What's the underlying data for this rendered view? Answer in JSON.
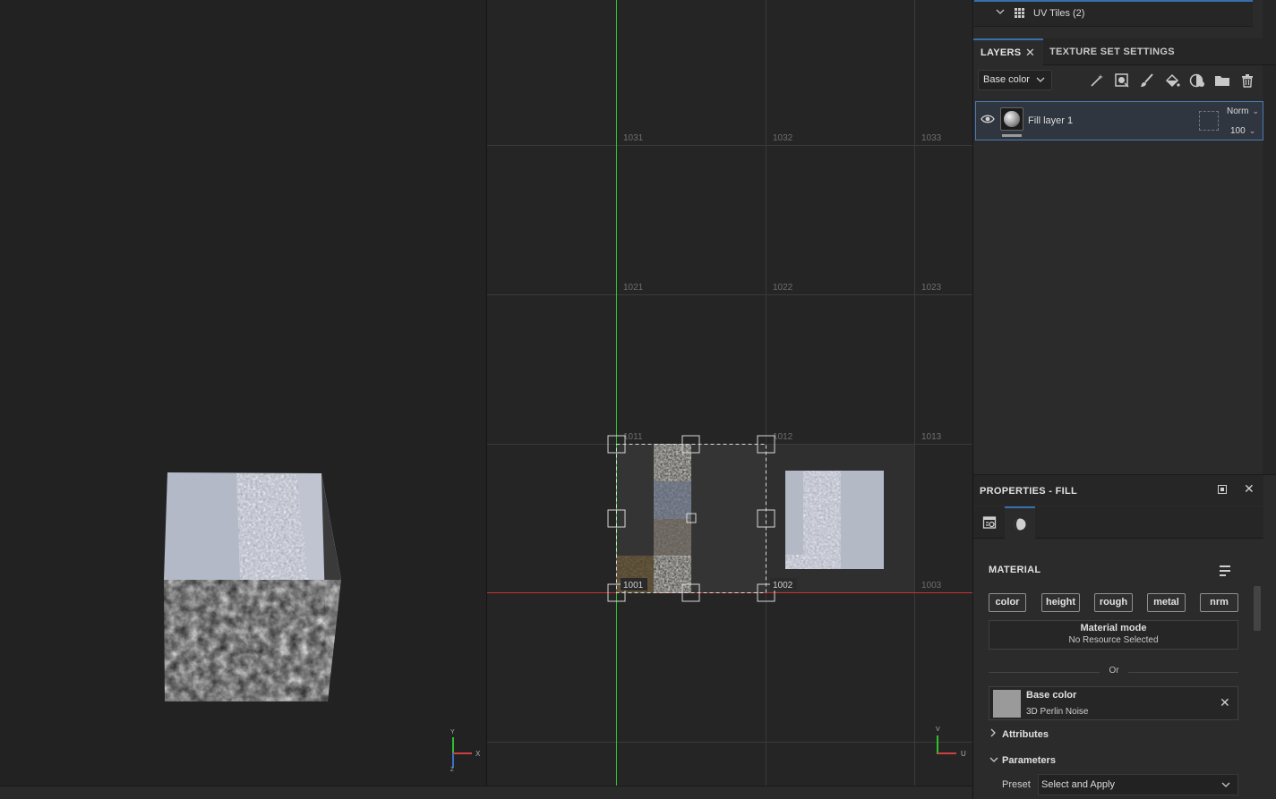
{
  "uv_tiles_row": {
    "label": "UV Tiles (2)"
  },
  "layers_panel": {
    "tabs": [
      {
        "label": "LAYERS",
        "close": "✕"
      },
      {
        "label": "TEXTURE SET SETTINGS"
      }
    ],
    "channel_select": "Base color",
    "toolbar_icons": [
      "magic-wand-icon",
      "add-mask-icon",
      "paint-layer-icon",
      "fill-layer-icon",
      "smart-material-icon",
      "folder-icon",
      "trash-icon"
    ],
    "layers": [
      {
        "name": "Fill layer 1",
        "blend_mode": "Norm",
        "opacity": "100"
      }
    ]
  },
  "properties_panel": {
    "title": "PROPERTIES - FILL",
    "close": "✕",
    "section_material": "MATERIAL",
    "channels": [
      "color",
      "height",
      "rough",
      "metal",
      "nrm"
    ],
    "material_mode": {
      "label": "Material mode",
      "value": "No Resource Selected"
    },
    "or_label": "Or",
    "base_color": {
      "label": "Base color",
      "value": "3D Perlin Noise",
      "swatch": "#9a9a9a"
    },
    "attributes_label": "Attributes",
    "parameters_label": "Parameters",
    "preset": {
      "label": "Preset",
      "value": "Select and Apply"
    }
  },
  "uv_editor": {
    "tile_labels": [
      "1031",
      "1032",
      "1033",
      "1021",
      "1022",
      "1023",
      "1011",
      "1012",
      "1013",
      "1001",
      "1002",
      "1003"
    ],
    "axis_gizmo": {
      "v": "V",
      "u": "U"
    }
  },
  "viewport_3d": {
    "axis_gizmo": {
      "y": "Y",
      "x": "X",
      "z": "Z"
    }
  },
  "colors": {
    "accent": "#3a6fae",
    "v_axis": "#2fbf2f",
    "u_axis": "#c83232"
  }
}
